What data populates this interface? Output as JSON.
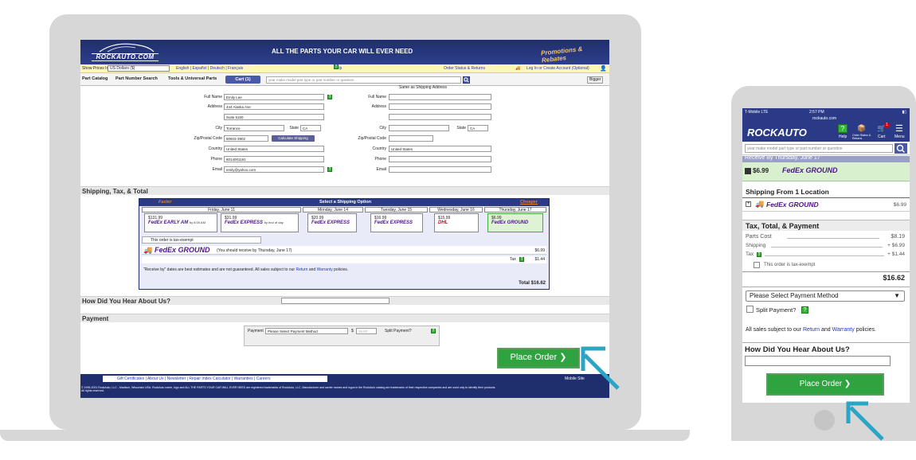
{
  "desktop": {
    "header": {
      "logo_text": "ROCKAUTO.COM",
      "slogan": "ALL THE PARTS YOUR CAR WILL EVER NEED",
      "promo": "Promotions & Rebates"
    },
    "bar1": {
      "show_prices_label": "Show Prices In",
      "currency": "US Dollars ($)",
      "languages": "English | Español | Deutsch | Français",
      "help": "Help",
      "order_status": "Order Status & Returns",
      "login": "Log In or Create Account (Optional)"
    },
    "bar2": {
      "tab_catalog": "Part Catalog",
      "tab_part_number": "Part Number Search",
      "tab_tools": "Tools & Universal Parts",
      "cart": "Cart (1)",
      "search_placeholder": "year make model part type or part number or question",
      "bigger": "Bigger"
    },
    "address": {
      "same_as": "Same as Shipping Address",
      "labels": {
        "full_name": "Full Name",
        "address": "Address",
        "city": "City",
        "state": "State",
        "zip": "Zip/Postal Code",
        "country": "Country",
        "phone": "Phone",
        "email": "Email"
      },
      "shipping": {
        "full_name": "Emily Lee",
        "address1": "444 Alaska Ave",
        "address2": "Suite 5150",
        "city": "Torrance",
        "state": "CA",
        "zip": "90503-3902",
        "country": "United States",
        "phone": "8014001161",
        "email": "emily@yahoo.com"
      },
      "billing": {
        "state": "CA",
        "country": "United States"
      },
      "calc_button": "Calculate Shipping"
    },
    "sections": {
      "shipping": "Shipping, Tax, & Total",
      "hear": "How Did You Hear About Us?",
      "payment": "Payment"
    },
    "shipping_box": {
      "faster": "Faster",
      "select_option": "Select a Shipping Option",
      "cheaper": "Cheaper",
      "days": [
        "Friday, June 11",
        "Monday, June 14",
        "Tuesday, June 15",
        "Wednesday, June 16",
        "Thursday, June 17"
      ],
      "options": [
        {
          "price": "$131.99",
          "carrier": "FedEx EARLY AM",
          "note": "by 8:00 AM"
        },
        {
          "price": "$31.99",
          "carrier": "FedEx EXPRESS",
          "note": "by end of day"
        },
        {
          "price": "$20.99",
          "carrier": "FedEx EXPRESS",
          "note": ""
        },
        {
          "price": "$16.99",
          "carrier": "FedEx EXPRESS",
          "note": ""
        },
        {
          "price": "$15.99",
          "carrier": "DHL",
          "note": ""
        },
        {
          "price": "$6.99",
          "carrier": "FedEx GROUND",
          "note": ""
        }
      ],
      "tax_exempt": "This order is tax-exempt",
      "selected_carrier": "FedEx GROUND",
      "selected_note": "(You should receive by Thursday, June 17)",
      "selected_price": "$6.99",
      "tax_label": "Tax",
      "tax_value": "$1.44",
      "disclaimer_pre": "\"Receive by\" dates are best estimates and are not guaranteed. All sales subject to our",
      "return_link": "Return",
      "and": "and",
      "warranty_link": "Warranty",
      "policies": "policies.",
      "total_label": "Total",
      "total_value": "$16.62"
    },
    "payment": {
      "label": "Payment",
      "method": "Please Select Payment Method",
      "amount_symbol": "$",
      "amount": "16.62",
      "split": "Split Payment?"
    },
    "place_order": "Place Order ❯",
    "footer": {
      "links": "Gift Certificates | About Us | Newsletter | Repair Index Calculator | Warranties | Careers",
      "mobile": "Mobile Site",
      "legal": "© 1999-2021 RockAuto, LLC - Madison, Wisconsin USA. RockAuto name, logo and ALL THE PARTS YOUR CAR WILL EVER NEED are registered trademarks of RockAuto, LLC. Manufacturer and carrier names and logos in the RockAuto catalog are trademarks of their respective companies and are used only to identify their products.",
      "legal2": "All rights reserved."
    }
  },
  "mobile": {
    "status": {
      "carrier": "T-Mobile LTE",
      "time": "2:57 PM",
      "url": "rockauto.com"
    },
    "header": {
      "logo": "ROCKAUTO",
      "help": "Help",
      "order_status": "Order Status & Returns",
      "cart": "Cart",
      "cart_count": "1",
      "menu": "Menu"
    },
    "search_placeholder": "year make model part type or part number or question",
    "receive_by": "Receive By Thursday, June 17",
    "price": "$6.99",
    "carrier": "FedEx GROUND",
    "shipping_from": "Shipping From 1 Location",
    "ship_price": "$6.99",
    "section_tax": "Tax, Total, & Payment",
    "parts_cost_label": "Parts Cost",
    "parts_cost": "$8.19",
    "shipping_label": "Shipping",
    "shipping_value": "+ $6.99",
    "tax_label": "Tax",
    "tax_value": "+ $1.44",
    "tax_exempt": "This order is tax-exempt",
    "total": "$16.62",
    "payment_method": "Please Select Payment Method",
    "split": "Split Payment?",
    "sales_pre": "All sales subject to our",
    "return_link": "Return",
    "and": "and",
    "warranty_link": "Warranty",
    "policies": "policies.",
    "hear": "How Did You Hear About Us?",
    "place_order": "Place Order ❯"
  }
}
